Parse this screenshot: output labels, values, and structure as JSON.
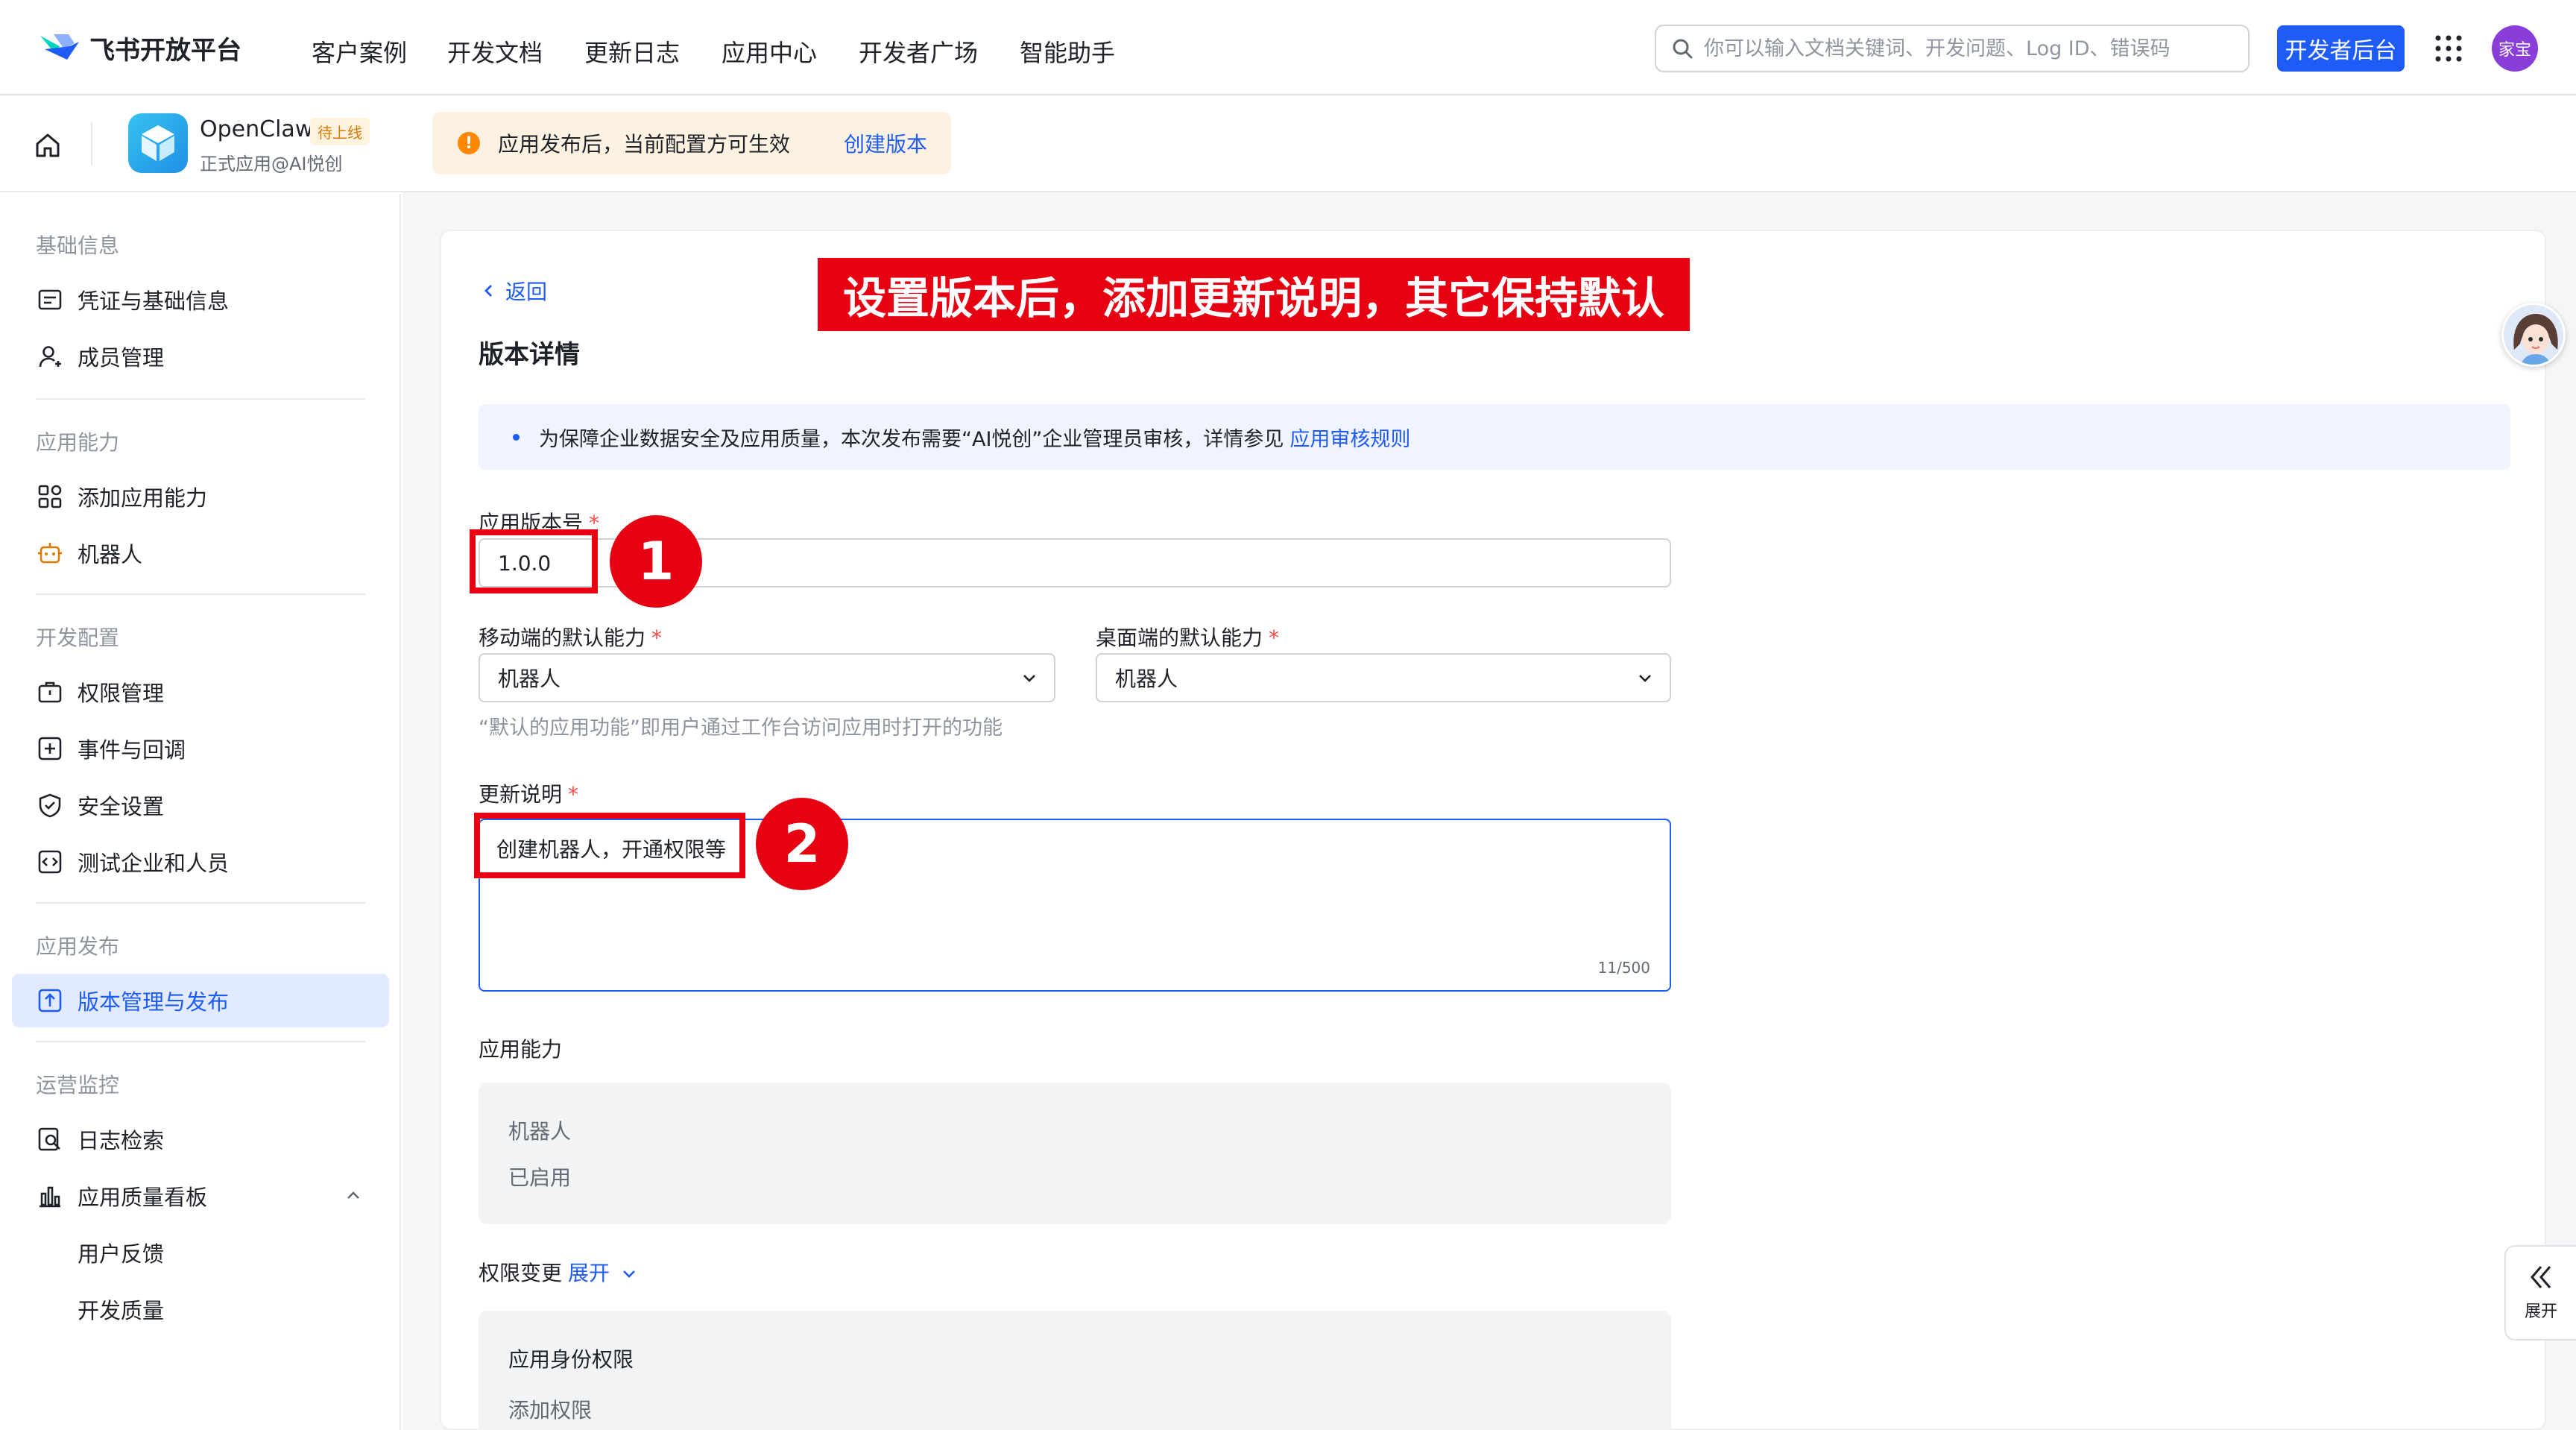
{
  "topnav": {
    "logo_text": "飞书开放平台",
    "items": [
      "客户案例",
      "开发文档",
      "更新日志",
      "应用中心",
      "开发者广场",
      "智能助手"
    ],
    "search_placeholder": "你可以输入文档关键词、开发问题、Log ID、错误码",
    "dev_console": "开发者后台",
    "avatar_text": "家宝"
  },
  "appbar": {
    "app_name": "OpenClaw",
    "app_status": "待上线",
    "app_sub": "正式应用@AI悦创",
    "notice_icon": "!",
    "notice_text": "应用发布后，当前配置方可生效",
    "notice_link": "创建版本"
  },
  "sidebar": {
    "sections": [
      {
        "title": "基础信息",
        "items": [
          "凭证与基础信息",
          "成员管理"
        ]
      },
      {
        "title": "应用能力",
        "items": [
          "添加应用能力",
          "机器人"
        ]
      },
      {
        "title": "开发配置",
        "items": [
          "权限管理",
          "事件与回调",
          "安全设置",
          "测试企业和人员"
        ]
      },
      {
        "title": "应用发布",
        "items": [
          "版本管理与发布"
        ]
      },
      {
        "title": "运营监控",
        "items": [
          "日志检索",
          "应用质量看板",
          "用户反馈",
          "开发质量"
        ]
      }
    ],
    "active_item": "版本管理与发布"
  },
  "main": {
    "back": "返回",
    "page_title": "版本详情",
    "annotation_banner": "设置版本后，添加更新说明，其它保持默认",
    "info_text": "为保障企业数据安全及应用质量，本次发布需要“AI悦创”企业管理员审核，详情参见",
    "info_link": "应用审核规则",
    "version_label": "应用版本号",
    "required_mark": "*",
    "version_value": "1.0.0",
    "mobile_label": "移动端的默认能力",
    "mobile_value": "机器人",
    "desktop_label": "桌面端的默认能力",
    "desktop_value": "机器人",
    "default_hint": "“默认的应用功能”即用户通过工作台访问应用时打开的功能",
    "notes_label": "更新说明",
    "notes_value": "创建机器人，开通权限等",
    "notes_counter": "11/500",
    "step1": "1",
    "step2": "2",
    "capability_title": "应用能力",
    "capability_name": "机器人",
    "capability_status": "已启用",
    "perm_title": "权限变更",
    "perm_expand": "展开",
    "perm_section": "应用身份权限",
    "perm_add": "添加权限"
  },
  "float": {
    "expand_label": "展开"
  },
  "colors": {
    "brand": "#1f5cf5",
    "annotation_red": "#e60012",
    "notice_bg": "#fdf1e2",
    "active_bg": "#e1eaff"
  },
  "icons": [
    "search-icon",
    "grid-menu-icon",
    "home-icon",
    "chevron-left-icon",
    "chevron-down-icon",
    "double-chevron-left-icon",
    "alert-icon"
  ]
}
